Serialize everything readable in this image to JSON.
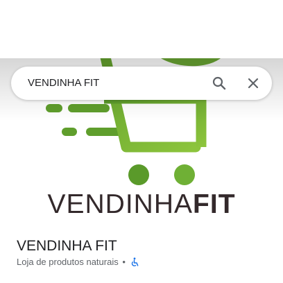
{
  "search": {
    "query": "VENDINHA FIT"
  },
  "logo": {
    "wordmark_light": "VENDINHA",
    "wordmark_bold": "FIT",
    "green_light": "#8cc43c",
    "green_dark": "#5a9a2a",
    "wordmark_color": "#33292b"
  },
  "place": {
    "name": "VENDINHA FIT",
    "category": "Loja de produtos naturais",
    "separator": "•",
    "accessibility_icon": "wheelchair-icon",
    "accessibility_color": "#1a73e8"
  },
  "icons": {
    "search": "search-icon",
    "close": "close-icon"
  }
}
